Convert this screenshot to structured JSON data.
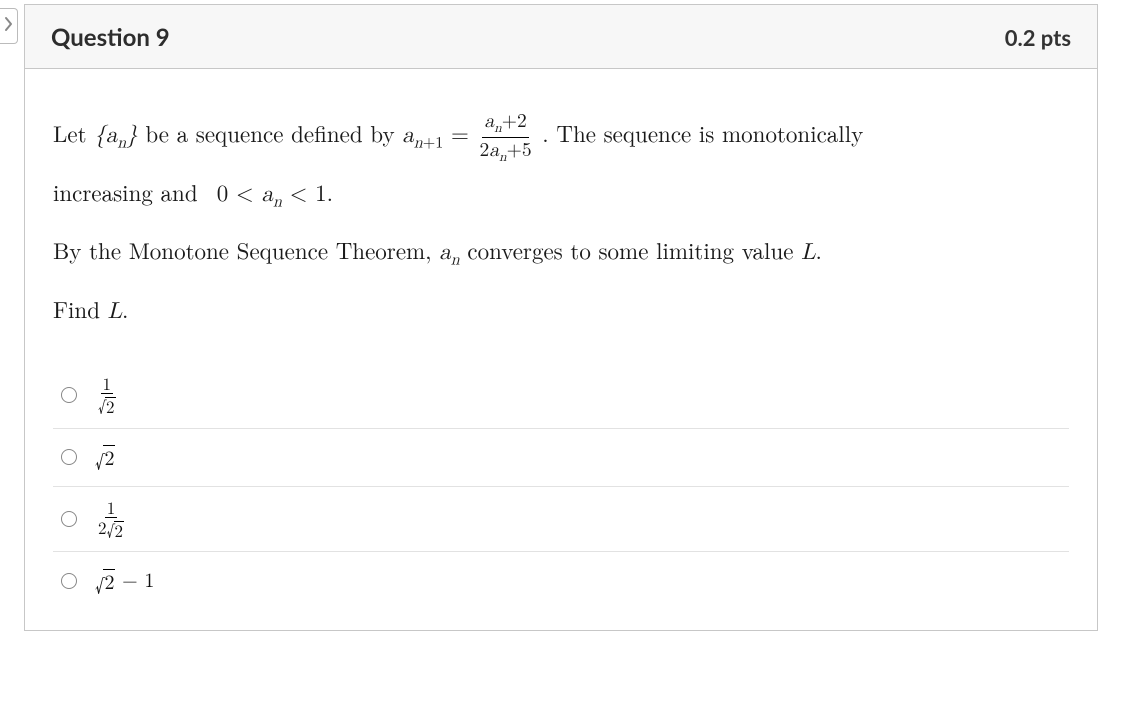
{
  "question": {
    "title": "Question 9",
    "points": "0.2 pts",
    "text_plain": "Let {a_n} be a sequence defined by a_{n+1} = (a_n + 2)/(2a_n + 5). The sequence is monotonically increasing and 0 < a_n < 1. By the Monotone Sequence Theorem, a_n converges to some limiting value L. Find L.",
    "answers": [
      {
        "label_plain": "1/√2"
      },
      {
        "label_plain": "√2"
      },
      {
        "label_plain": "1/(2√2)"
      },
      {
        "label_plain": "√2 − 1"
      }
    ]
  }
}
